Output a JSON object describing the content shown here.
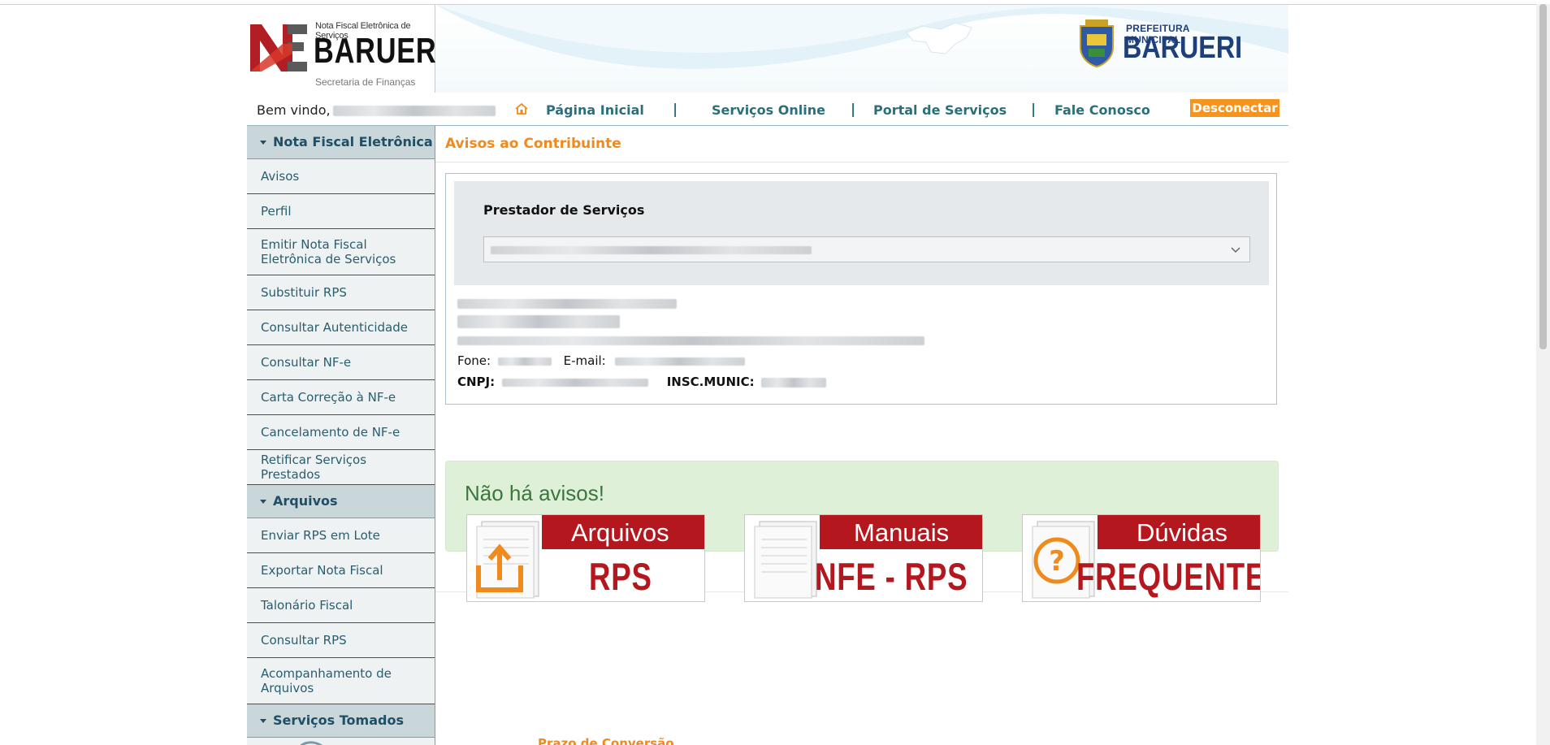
{
  "header": {
    "logo_small": "Nota Fiscal Eletrônica de Serviços",
    "logo_big": "BARUERI",
    "logo_sub": "Secretaria de Finanças",
    "pref_small": "PREFEITURA MUNICIPAL",
    "pref_big": "BARUERI"
  },
  "nav": {
    "welcome": "Bem vindo,",
    "links": [
      "Página Inicial",
      "Serviços Online",
      "Portal de Serviços",
      "Fale Conosco"
    ],
    "separator": "|",
    "disconnect": "Desconectar"
  },
  "sidebar": {
    "section1": "Nota Fiscal Eletrônica",
    "items1": [
      "Avisos",
      "Perfil",
      "Emitir Nota Fiscal Eletrônica de Serviços",
      "Substituir RPS",
      "Consultar Autenticidade",
      "Consultar NF-e",
      "Carta Correção à  NF-e",
      "Cancelamento de NF-e",
      "Retificar Serviços Prestados"
    ],
    "section2": "Arquivos",
    "items2": [
      "Enviar RPS em Lote",
      "Exportar Nota Fiscal",
      "Talonário Fiscal",
      "Consultar RPS",
      "Acompanhamento de Arquivos"
    ],
    "section3": "Serviços Tomados"
  },
  "main": {
    "title": "Avisos ao Contribuinte",
    "prestador_label": "Prestador de Serviços",
    "fone_label": "Fone:",
    "email_label": "E-mail:",
    "cnpj_label": "CNPJ:",
    "insc_label": "INSC.MUNIC:",
    "alert": "Não há avisos!",
    "tiles": [
      {
        "line1": "Arquivos",
        "line2": "RPS"
      },
      {
        "line1": "Manuais",
        "line2": "NFE - RPS"
      },
      {
        "line1": "Dúvidas",
        "line2": "FREQUENTES"
      }
    ],
    "prazo": "Prazo de Conversão"
  },
  "colors": {
    "accent_orange": "#f08a1c",
    "nav_teal": "#2b6f7a",
    "tile_red": "#b4181e",
    "alert_green": "#dff0d8"
  }
}
